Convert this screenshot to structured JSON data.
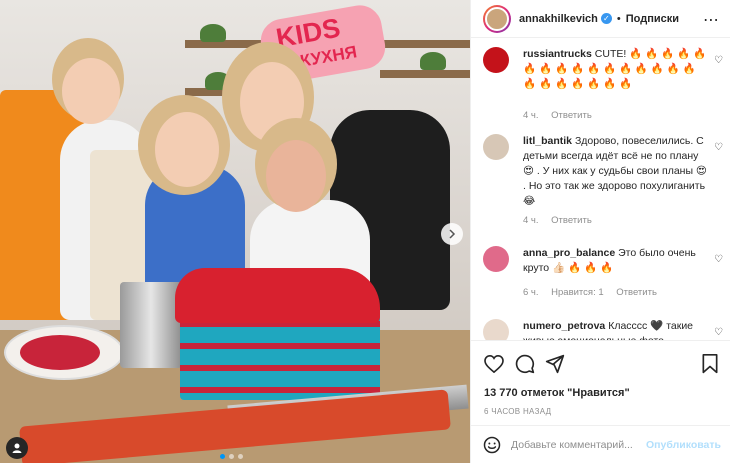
{
  "header": {
    "username": "annakhilkevich",
    "separator": "•",
    "follow_label": "Подписки",
    "more_icon": "more-horizontal-icon"
  },
  "media": {
    "sign_title": "KIDS",
    "sign_subtitle": "КУХНЯ",
    "carousel_dots": 3,
    "active_dot": 0
  },
  "comments": [
    {
      "username": "russiantrucks",
      "text": "CUTE! 🔥 🔥 🔥 🔥 🔥 🔥 🔥 🔥 🔥 🔥 🔥 🔥 🔥 🔥 🔥 🔥 🔥 🔥 🔥 🔥 🔥 🔥 🔥",
      "time": "4 ч.",
      "likes": "",
      "reply_label": "Ответить",
      "avatar_color": "#c4121a"
    },
    {
      "username": "litl_bantik",
      "text": "Здорово, повеселились. С детьми всегда идёт всё не по плану 😍 . У них как у судьбы свои планы 😍 . Но это так же здорово похулиганить 😂",
      "time": "4 ч.",
      "likes": "",
      "reply_label": "Ответить",
      "avatar_color": "#d7c7b6"
    },
    {
      "username": "anna_pro_balance",
      "text": "Это было очень круто 👍🏻 🔥 🔥 🔥",
      "time": "6 ч.",
      "likes": "Нравится: 1",
      "reply_label": "Ответить",
      "avatar_color": "#e06a8a"
    },
    {
      "username": "numero_petrova",
      "text": "Класссс 🖤 такие живые эмоциональные фото",
      "time": "",
      "likes": "",
      "reply_label": "",
      "avatar_color": "#e9d9cc"
    }
  ],
  "actions": {
    "like_icon": "heart-icon",
    "comment_icon": "comment-icon",
    "share_icon": "share-icon",
    "save_icon": "bookmark-icon"
  },
  "likes_text": "13 770 отметок \"Нравится\"",
  "posted_time": "6 ЧАСОВ НАЗАД",
  "composer": {
    "placeholder": "Добавьте комментарий...",
    "publish_label": "Опубликовать",
    "emoji_icon": "emoji-icon"
  }
}
